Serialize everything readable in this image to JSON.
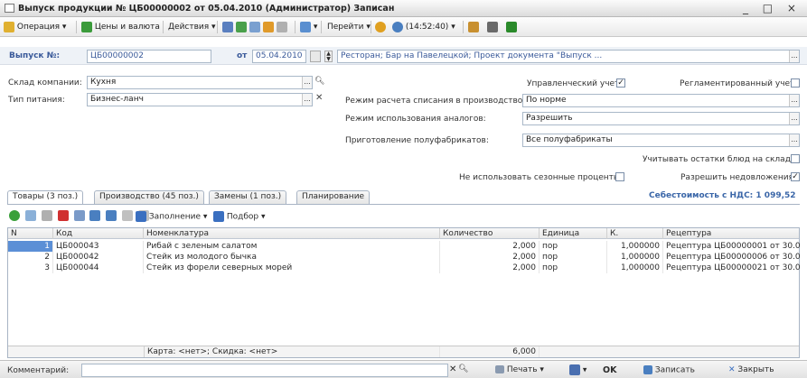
{
  "window": {
    "title": "Выпуск продукции № ЦБ00000002 от 05.04.2010 (Администратор) Записан",
    "controls": "_ □ ×"
  },
  "toolbar": {
    "operation": "Операция",
    "prices": "Цены и валюта",
    "actions": "Действия",
    "goto": "Перейти",
    "time": "(14:52:40)"
  },
  "header": {
    "number_label": "Выпуск №:",
    "number_value": "ЦБ00000002",
    "date_label": "от",
    "date_value": "05.04.2010",
    "description": "Ресторан; Бар на Павелецкой; Проект документа \"Выпуск ..."
  },
  "form": {
    "warehouse_label": "Склад компании:",
    "warehouse_value": "Кухня",
    "food_type_label": "Тип питания:",
    "food_type_value": "Бизнес-ланч",
    "mgmt_label": "Управленческий учет",
    "mgmt_checked": "✓",
    "reg_label": "Регламентированный учет",
    "writeoff_label": "Режим расчета списания в производство:",
    "writeoff_value": "По норме",
    "analog_label": "Режим использования аналогов:",
    "analog_value": "Разрешить",
    "semi_label": "Приготовление полуфабрикатов:",
    "semi_value": "Все полуфабрикаты",
    "stock_label": "Учитывать остатки блюд на складе",
    "seasonal_label": "Не использовать сезонные проценты",
    "shortage_label": "Разрешить недовложения",
    "shortage_checked": "✓",
    "cost_text": "Себестоимость с НДС: 1 099,52"
  },
  "tabs": [
    {
      "label": "Товары (3 поз.)"
    },
    {
      "label": "Производство (45 поз.)"
    },
    {
      "label": "Замены (1 поз.)"
    },
    {
      "label": "Планирование"
    }
  ],
  "gridtoolbar": {
    "fill": "Заполнение",
    "pick": "Подбор"
  },
  "table": {
    "columns": [
      "N",
      "Код",
      "Номенклатура",
      "Количество",
      "Единица",
      "К.",
      "Рецептура"
    ],
    "rows": [
      {
        "n": "1",
        "code": "ЦБ000043",
        "name": "Рибай с зеленым салатом",
        "qty": "2,000",
        "unit": "пор",
        "k": "1,000000",
        "recipe": "Рецептура ЦБ00000001 от 30.0..."
      },
      {
        "n": "2",
        "code": "ЦБ000042",
        "name": "Стейк из молодого бычка",
        "qty": "2,000",
        "unit": "пор",
        "k": "1,000000",
        "recipe": "Рецептура ЦБ00000006 от 30.0..."
      },
      {
        "n": "3",
        "code": "ЦБ000044",
        "name": "Стейк из форели северных морей",
        "qty": "2,000",
        "unit": "пор",
        "k": "1,000000",
        "recipe": "Рецептура ЦБ00000021 от 30.0..."
      }
    ],
    "footer_card": "Карта: <нет>; Скидка: <нет>",
    "footer_qty": "6,000"
  },
  "bottom": {
    "comment_label": "Комментарий:",
    "print": "Печать",
    "ok": "OK",
    "save": "Записать",
    "close": "Закрыть"
  }
}
